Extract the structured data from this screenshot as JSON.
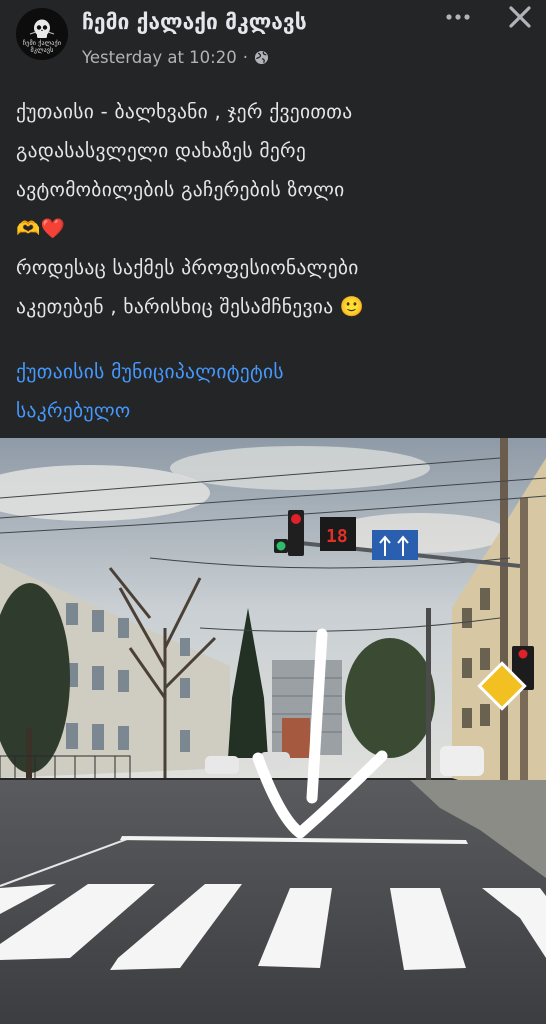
{
  "post": {
    "page_name": "ჩემი ქალაქი მკლავს",
    "timestamp": "Yesterday at 10:20",
    "privacy_separator": "·",
    "privacy": "public",
    "avatar_text": "ჩემი ქალაქი მკლავს",
    "text_lines": [
      "ქუთაისი - ბალხვანი , ჯერ ქვეითთა",
      "გადასასვლელი დახაზეს მერე",
      "ავტომობილების გაჩერების ზოლი",
      "🫶❤️",
      "როდესაც საქმეს პროფესიონალები",
      "აკეთებენ , ხარისხიც შესამჩნევია 🙂"
    ],
    "hashtag_lines": [
      "ქუთაისის მუნიციპალიტეტის",
      "საკრებულო"
    ]
  },
  "icons": {
    "more": "more-horizontal-icon",
    "close": "close-icon",
    "privacy": "globe-icon"
  },
  "colors": {
    "background": "#242526",
    "text": "#e4e6eb",
    "secondary_text": "#b0b3b8",
    "link": "#4599ff"
  }
}
